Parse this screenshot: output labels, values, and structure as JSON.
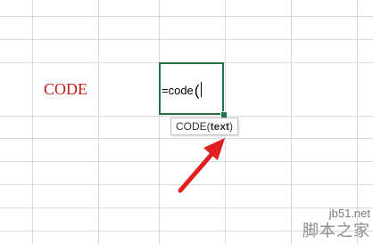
{
  "cell": {
    "label": "CODE",
    "label_color": "#c41a1a"
  },
  "formula": {
    "text": "=code",
    "open_paren": "("
  },
  "tooltip": {
    "func_name": "CODE(",
    "arg": "text",
    "close": ")"
  },
  "annotation": {
    "arrow_color": "#e02020"
  },
  "watermark": {
    "site": "jb51.net",
    "brand": "脚本之家"
  },
  "colors": {
    "active_border": "#217346",
    "gridline": "#dadada"
  }
}
